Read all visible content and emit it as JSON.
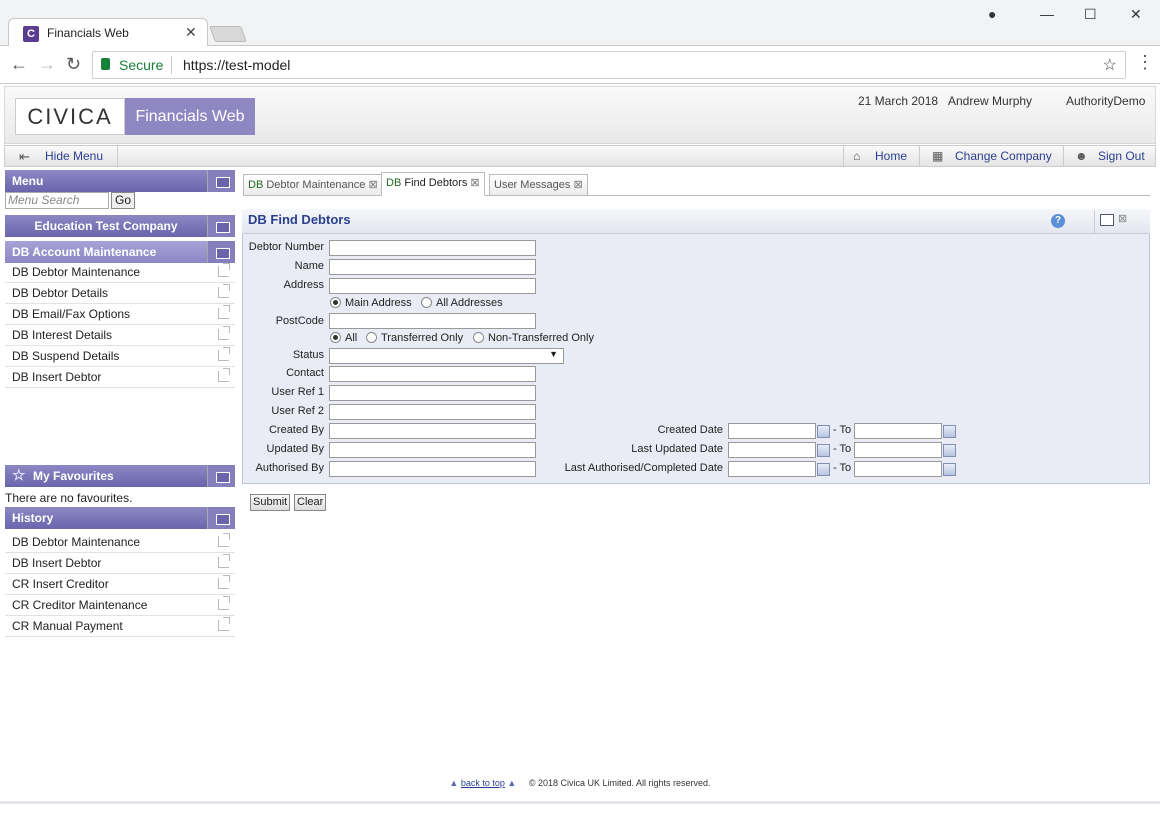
{
  "browser": {
    "tab_title": "Financials Web",
    "tab_favicon": "C",
    "secure_label": "Secure",
    "url": "https://test-model"
  },
  "header": {
    "logo": "CIVICA",
    "product": "Financials Web",
    "date": "21 March 2018",
    "user": "Andrew Murphy",
    "authority": "AuthorityDemo"
  },
  "menubar": {
    "hide_menu": "Hide Menu",
    "home": "Home",
    "change_company": "Change Company",
    "sign_out": "Sign Out"
  },
  "sidebar": {
    "menu_title": "Menu",
    "search_placeholder": "Menu Search",
    "go_label": "Go",
    "company": "Education Test Company",
    "section": "DB Account Maintenance",
    "items": [
      {
        "label": "DB Debtor Maintenance"
      },
      {
        "label": "DB Debtor Details"
      },
      {
        "label": "DB Email/Fax Options"
      },
      {
        "label": "DB Interest Details"
      },
      {
        "label": "DB Suspend Details"
      },
      {
        "label": "DB Insert Debtor"
      }
    ],
    "favourites_title": "My Favourites",
    "favourites_empty": "There are no favourites.",
    "history_title": "History",
    "history": [
      {
        "label": "DB Debtor Maintenance"
      },
      {
        "label": "DB Insert Debtor"
      },
      {
        "label": "CR Insert Creditor"
      },
      {
        "label": "CR Creditor Maintenance"
      },
      {
        "label": "CR Manual Payment"
      }
    ]
  },
  "content_tabs": [
    {
      "prefix": "DB",
      "label": "Debtor Maintenance",
      "active": false
    },
    {
      "prefix": "DB",
      "label": "Find Debtors",
      "active": true
    },
    {
      "prefix": "",
      "label": "User Messages",
      "active": false
    }
  ],
  "form": {
    "title": "DB Find Debtors",
    "labels": {
      "debtor_number": "Debtor Number",
      "name": "Name",
      "address": "Address",
      "postcode": "PostCode",
      "status": "Status",
      "contact": "Contact",
      "user_ref1": "User Ref 1",
      "user_ref2": "User Ref 2",
      "created_by": "Created By",
      "updated_by": "Updated By",
      "authorised_by": "Authorised By",
      "created_date": "Created Date",
      "last_updated_date": "Last Updated Date",
      "last_authorised_date": "Last Authorised/Completed Date",
      "to": "- To"
    },
    "address_options": [
      "Main Address",
      "All Addresses"
    ],
    "address_selected": "Main Address",
    "transfer_options": [
      "All",
      "Transferred Only",
      "Non-Transferred Only"
    ],
    "transfer_selected": "All",
    "status_value": "",
    "submit_label": "Submit",
    "clear_label": "Clear"
  },
  "footer": {
    "back_to_top": "back to top",
    "copyright": "© 2018 Civica UK Limited. All rights reserved."
  },
  "colors": {
    "brand_purple": "#8e87c2",
    "panel_header": "#6a64ac",
    "link_blue": "#2a3f8f"
  }
}
